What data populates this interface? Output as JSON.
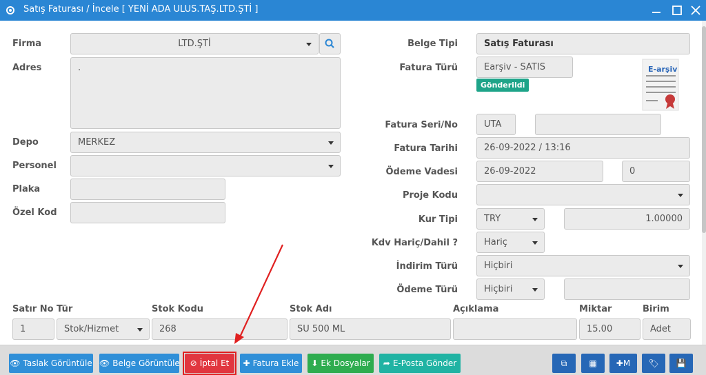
{
  "window": {
    "title": "Satış Faturası / İncele [ YENİ ADA ULUS.TAŞ.LTD.ŞTİ ]"
  },
  "left_form": {
    "firma_label": "Firma",
    "firma_value": "LTD.ŞTİ",
    "adres_label": "Adres",
    "adres_value": ".",
    "depo_label": "Depo",
    "depo_value": "MERKEZ",
    "personel_label": "Personel",
    "personel_value": "",
    "plaka_label": "Plaka",
    "plaka_value": "",
    "ozel_kod_label": "Özel Kod",
    "ozel_kod_value": ""
  },
  "right_form": {
    "belge_tipi_label": "Belge Tipi",
    "belge_tipi_value": "Satış Faturası",
    "fatura_turu_label": "Fatura Türü",
    "fatura_turu_value": "Earşiv - SATIS",
    "status_badge": "Gönderildi",
    "earsiv_label": "E-arşiv",
    "fatura_seri_label": "Fatura Seri/No",
    "fatura_seri_value": "UTA",
    "fatura_no_value": "",
    "fatura_tarihi_label": "Fatura Tarihi",
    "fatura_tarihi_value": "26-09-2022  / 13:16",
    "odeme_vadesi_label": "Ödeme Vadesi",
    "odeme_vadesi_value": "26-09-2022",
    "vade_gun_value": "0",
    "proje_kodu_label": "Proje Kodu",
    "proje_kodu_value": "",
    "kur_tipi_label": "Kur Tipi",
    "kur_tipi_value": "TRY",
    "kur_value": "1.00000",
    "kdv_label": "Kdv Hariç/Dahil ?",
    "kdv_value": "Hariç",
    "indirim_label": "İndirim Türü",
    "indirim_value": "Hiçbiri",
    "odeme_turu_label": "Ödeme Türü",
    "odeme_turu_value": "Hiçbiri",
    "odeme_turu_extra": ""
  },
  "table": {
    "headers": [
      "Satır No",
      "Tür",
      "Stok Kodu",
      "Stok Adı",
      "Açıklama",
      "Miktar",
      "Birim"
    ],
    "row": {
      "satir_no": "1",
      "tur": "Stok/Hizmet",
      "stok_kodu": "268",
      "stok_adi": "SU 500 ML",
      "aciklama": "",
      "miktar": "15.00",
      "birim": "Adet"
    }
  },
  "footer": {
    "taslak": "Taslak Görüntüle",
    "belge": "Belge Görüntüle",
    "iptal": "İptal Et",
    "fatura_ekle": "Fatura Ekle",
    "ek_dosyalar": "Ek Dosyalar",
    "eposta": "E-Posta Gönder",
    "m_label": "M"
  },
  "colors": {
    "titlebar": "#2a86d4",
    "button_blue": "#2f8fd8",
    "button_red": "#e1363f",
    "button_green": "#2eac4f",
    "button_teal": "#20b3a3",
    "badge": "#1ea489",
    "annotation": "#e02020"
  }
}
